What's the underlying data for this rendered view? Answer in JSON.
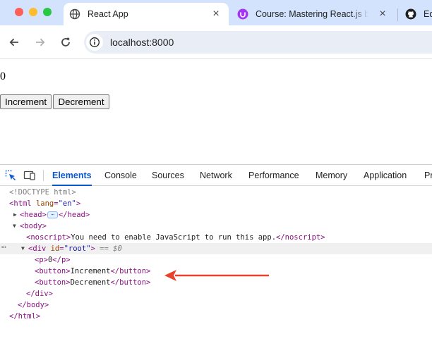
{
  "browser": {
    "tabs": [
      {
        "title": "React App",
        "favicon": "globe-icon",
        "active": true
      },
      {
        "title": "Course: Mastering React.js by",
        "favicon": "course-icon",
        "active": false
      },
      {
        "title": "Ed",
        "favicon": "github-icon",
        "active": false
      }
    ],
    "close_glyph": "×",
    "url": "localhost:8000"
  },
  "page": {
    "counter": "0",
    "increment_label": "Increment",
    "decrement_label": "Decrement"
  },
  "devtools": {
    "tabs": [
      "Elements",
      "Console",
      "Sources",
      "Network",
      "Performance",
      "Memory",
      "Application",
      "Pr"
    ],
    "active_tab": "Elements",
    "tree": {
      "doctype": "<!DOCTYPE html>",
      "html_tag": "<html ",
      "html_attr": "lang",
      "html_eq": "=",
      "html_val": "\"en\"",
      "html_close_bracket": ">",
      "head_open": "<head>",
      "head_badge": "⋯",
      "head_close": "</head>",
      "body_open": "<body>",
      "noscript_open": "<noscript>",
      "noscript_text": "You need to enable JavaScript to run this app.",
      "noscript_close": "</noscript>",
      "div_tag": "<div ",
      "div_attr": "id",
      "div_eq": "=",
      "div_val": "\"root\"",
      "div_close_bracket": ">",
      "div_eqeq": " == ",
      "div_dollar": "$0",
      "p_open": "<p>",
      "p_text": "0",
      "p_close": "</p>",
      "btn1_open": "<button>",
      "btn1_text": "Increment",
      "btn1_close": "</button>",
      "btn2_open": "<button>",
      "btn2_text": "Decrement",
      "btn2_close": "</button>",
      "div_end": "</div>",
      "body_end": "</body>",
      "html_end": "</html>",
      "dots": "⋯"
    }
  },
  "colors": {
    "tabstrip": "#d3e3fd",
    "accent": "#0b57d0",
    "annotation_arrow": "#e8412c"
  }
}
